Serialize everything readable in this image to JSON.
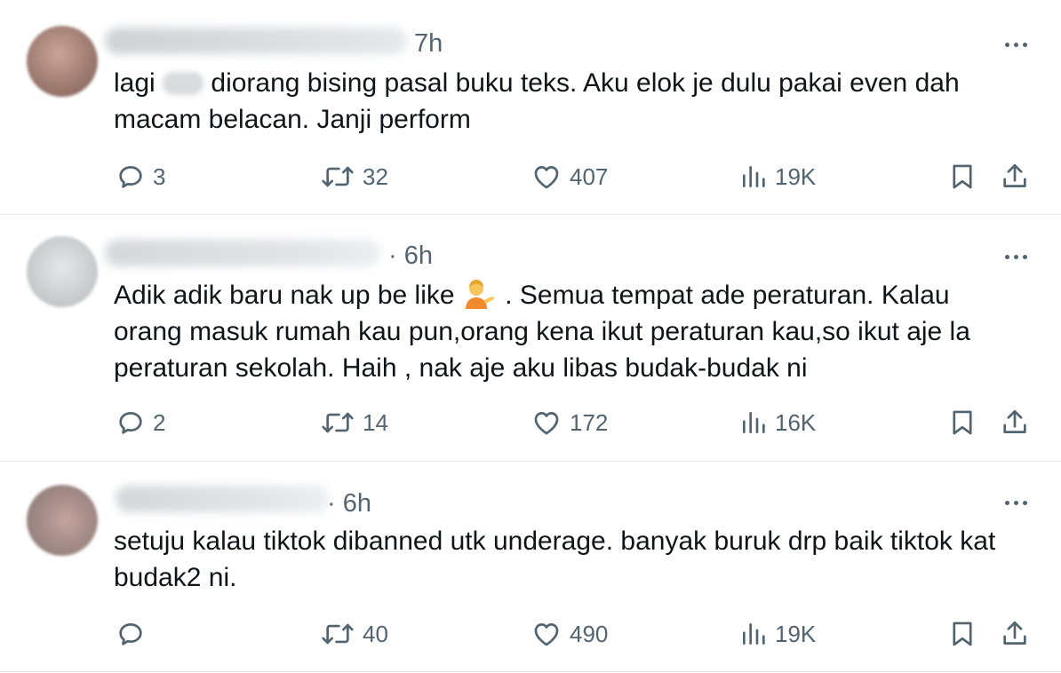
{
  "posts": [
    {
      "time": "7h",
      "text_before_redact": "lagi ",
      "text_after_redact": " diorang bising pasal buku teks. Aku elok je dulu pakai even dah",
      "text_line2": "macam belacan. Janji perform",
      "replies": "3",
      "reposts": "32",
      "likes": "407",
      "views": "19K"
    },
    {
      "time": "· 6h",
      "text_line1_before_emoji": "Adik adik baru nak up be like ",
      "text_line1_after_emoji": " . Semua tempat ade peraturan. Kalau",
      "text_line2": "orang masuk rumah kau pun,orang kena ikut peraturan kau,so ikut aje la",
      "text_line3": "peraturan sekolah. Haih , nak aje aku libas budak-budak ni",
      "replies": "2",
      "reposts": "14",
      "likes": "172",
      "views": "16K"
    },
    {
      "time": "· 6h",
      "text_line1": "setuju kalau tiktok dibanned utk underage. banyak buruk drp baik tiktok kat",
      "text_line2": "budak2 ni.",
      "replies": "",
      "reposts": "40",
      "likes": "490",
      "views": "19K"
    }
  ],
  "icons": {
    "reply": "reply-icon",
    "repost": "repost-icon",
    "like": "heart-icon",
    "views": "views-icon",
    "bookmark": "bookmark-icon",
    "share": "share-icon",
    "more": "more-icon",
    "emoji": "person-tipping-hand-emoji"
  },
  "colors": {
    "text": "#0f1419",
    "secondary": "#536471",
    "divider": "#e3e7ea"
  }
}
